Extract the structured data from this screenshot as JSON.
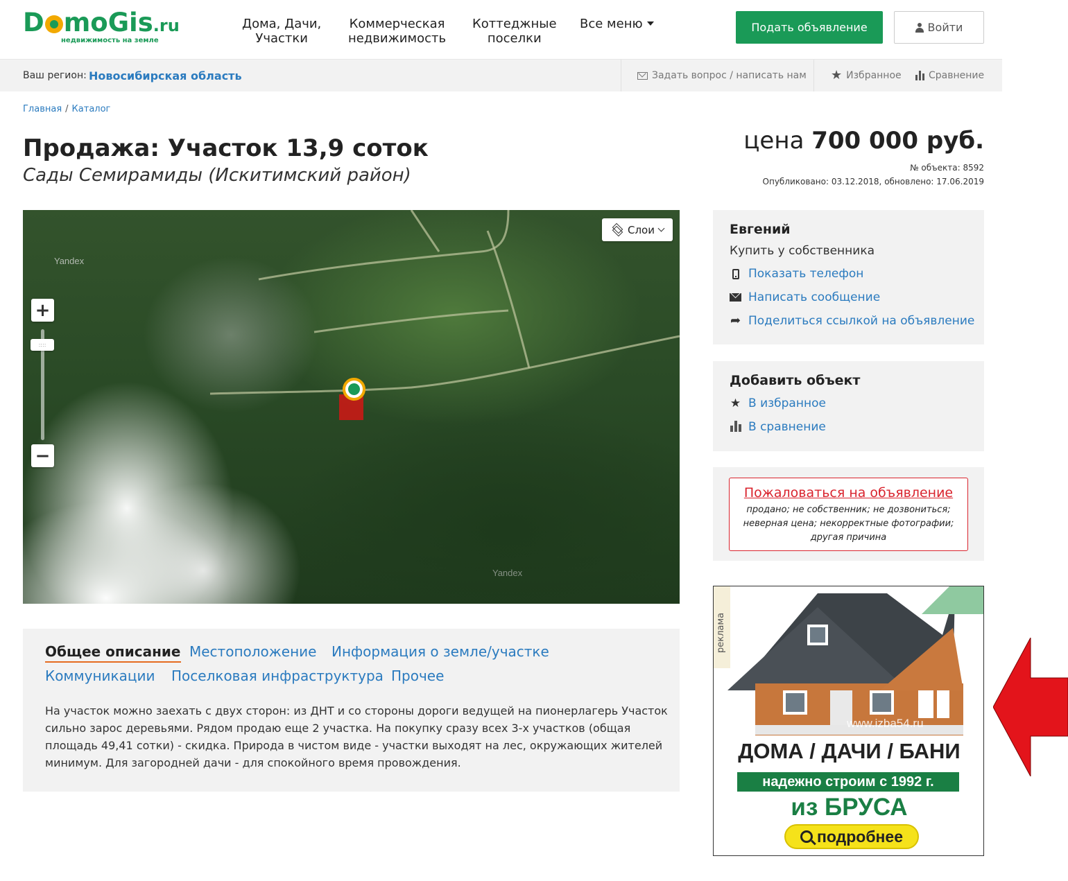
{
  "header": {
    "logo_text": "DomoGis",
    "logo_tld": ".ru",
    "logo_tagline": "недвижимость на земле",
    "nav": [
      {
        "label_1": "Дома, Дачи,",
        "label_2": "Участки"
      },
      {
        "label_1": "Коммерческая",
        "label_2": "недвижимость"
      },
      {
        "label_1": "Коттеджные",
        "label_2": "поселки"
      }
    ],
    "nav_more": "Все меню",
    "post_button": "Подать объявление",
    "login_button": "Войти"
  },
  "subbar": {
    "region_label": "Ваш регион:",
    "region_value": "Новосибирская область",
    "ask": "Задать вопрос / написать нам",
    "favorites": "Избранное",
    "compare": "Сравнение"
  },
  "breadcrumb": {
    "home": "Главная",
    "separator": "/",
    "catalog": "Каталог"
  },
  "listing": {
    "title": "Продажа: Участок 13,9 соток",
    "subtitle": "Сады Семирамиды (Искитимский район)",
    "price_prefix": "цена",
    "price_value": "700 000 руб.",
    "object_number": "№ объекта: 8592",
    "published": "Опубликовано: 03.12.2018, обновлено: 17.06.2019"
  },
  "map": {
    "layers_label": "Слои",
    "zoom_in": "+",
    "zoom_out": "−",
    "watermark": "Yandex"
  },
  "seller": {
    "name": "Евгений",
    "type": "Купить у собственника",
    "show_phone": "Показать телефон",
    "write_message": "Написать сообщение",
    "share_link": "Поделиться ссылкой на объявление"
  },
  "add_object": {
    "title": "Добавить объект",
    "to_favorites": "В избранное",
    "to_compare": "В сравнение"
  },
  "report": {
    "link": "Пожаловаться на объявление",
    "reasons": "продано; не собственник; не дозвониться; неверная цена; некорректные фотографии; другая причина"
  },
  "ad": {
    "tag": "реклама",
    "watermark": "www.izba54.ru",
    "headline": "ДОМА / ДАЧИ / БАНИ",
    "band": "надежно строим с 1992 г.",
    "material": "из БРУСА",
    "more_button": "подробнее"
  },
  "description": {
    "tabs": [
      {
        "label": "Общее описание",
        "active": true
      },
      {
        "label": "Местоположение",
        "active": false
      },
      {
        "label": "Информация о земле/участке",
        "active": false
      },
      {
        "label": "Коммуникации",
        "active": false
      },
      {
        "label": "Поселковая инфраструктура",
        "active": false
      },
      {
        "label": "Прочее",
        "active": false
      }
    ],
    "text": "На участок можно заехать с двух сторон: из ДНТ и со стороны дороги ведущей на пионерлагерь Участок сильно зарос деревьями. Рядом продаю еще 2 участка. На покупку сразу всех 3-х участков (общая площадь 49,41 сотки) - скидка. Природа в чистом виде - участки выходят на лес, окружающих жителей минимум. Для загородней дачи - для спокойного время провождения."
  },
  "colors": {
    "brand_green": "#1a9a57",
    "link_blue": "#2b7bbf",
    "report_red": "#d9232d",
    "tab_underline": "#e56b1f",
    "arrow_red": "#e3141b"
  },
  "icons": {
    "login": "user-icon",
    "ask": "envelope-icon",
    "favorites": "star-icon",
    "compare": "bar-chart-icon",
    "phone": "mobile-phone-icon",
    "message": "envelope-icon",
    "share": "share-arrow-icon",
    "layers": "layers-icon",
    "more": "magnifier-icon"
  }
}
